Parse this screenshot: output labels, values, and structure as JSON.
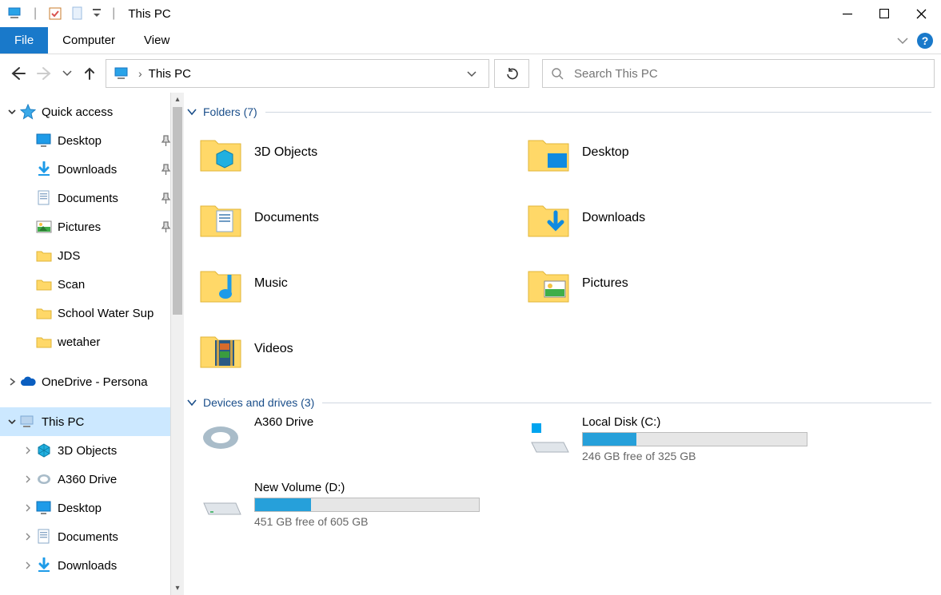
{
  "title": "This PC",
  "ribbon": {
    "file": "File",
    "tabs": [
      "Computer",
      "View"
    ]
  },
  "address": {
    "crumb": "This PC"
  },
  "search": {
    "placeholder": "Search This PC"
  },
  "sidebar": {
    "quick_access": {
      "label": "Quick access",
      "items": [
        {
          "label": "Desktop",
          "pinned": true,
          "icon": "desktop"
        },
        {
          "label": "Downloads",
          "pinned": true,
          "icon": "download"
        },
        {
          "label": "Documents",
          "pinned": true,
          "icon": "document"
        },
        {
          "label": "Pictures",
          "pinned": true,
          "icon": "picture"
        },
        {
          "label": "JDS",
          "pinned": false,
          "icon": "folder"
        },
        {
          "label": "Scan",
          "pinned": false,
          "icon": "folder"
        },
        {
          "label": "School Water Sup",
          "pinned": false,
          "icon": "folder"
        },
        {
          "label": "wetaher",
          "pinned": false,
          "icon": "folder"
        }
      ]
    },
    "onedrive": {
      "label": "OneDrive - Persona"
    },
    "this_pc": {
      "label": "This PC",
      "items": [
        {
          "label": "3D Objects",
          "icon": "3d"
        },
        {
          "label": "A360 Drive",
          "icon": "a360"
        },
        {
          "label": "Desktop",
          "icon": "desktop"
        },
        {
          "label": "Documents",
          "icon": "document"
        },
        {
          "label": "Downloads",
          "icon": "download"
        }
      ]
    }
  },
  "groups": {
    "folders": {
      "header": "Folders (7)",
      "items": [
        {
          "label": "3D Objects",
          "icon": "3d"
        },
        {
          "label": "Desktop",
          "icon": "desktop"
        },
        {
          "label": "Documents",
          "icon": "document"
        },
        {
          "label": "Downloads",
          "icon": "download"
        },
        {
          "label": "Music",
          "icon": "music"
        },
        {
          "label": "Pictures",
          "icon": "picture"
        },
        {
          "label": "Videos",
          "icon": "video"
        }
      ]
    },
    "drives": {
      "header": "Devices and drives (3)",
      "items": [
        {
          "label": "A360 Drive",
          "icon": "a360",
          "bar": false
        },
        {
          "label": "Local Disk (C:)",
          "icon": "cdisk",
          "bar": true,
          "fill_pct": 24,
          "status": "246 GB free of 325 GB"
        },
        {
          "label": "New Volume (D:)",
          "icon": "ddisk",
          "bar": true,
          "fill_pct": 25,
          "status": "451 GB free of 605 GB"
        }
      ]
    }
  }
}
